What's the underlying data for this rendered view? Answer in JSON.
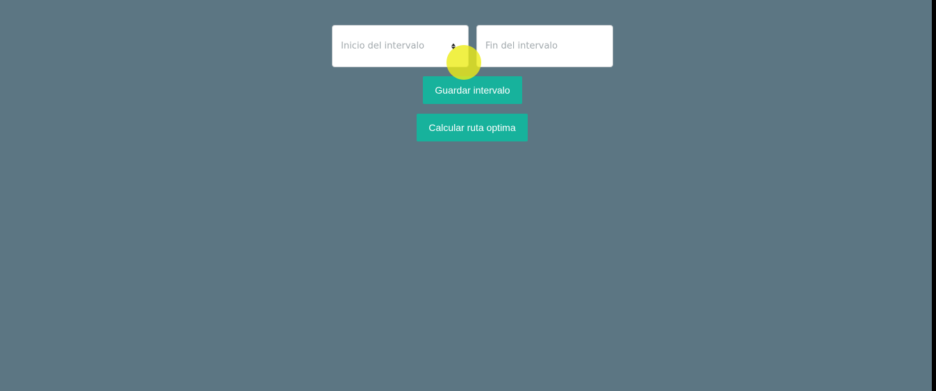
{
  "form": {
    "start_field": {
      "placeholder": "Inicio del intervalo",
      "value": ""
    },
    "end_field": {
      "placeholder": "Fin del intervalo",
      "value": ""
    }
  },
  "actions": {
    "save_label": "Guardar intervalo",
    "calculate_label": "Calcular ruta optima"
  },
  "colors": {
    "background": "#5c7683",
    "button": "#17b29c",
    "cursor_highlight": "#ecec18"
  }
}
